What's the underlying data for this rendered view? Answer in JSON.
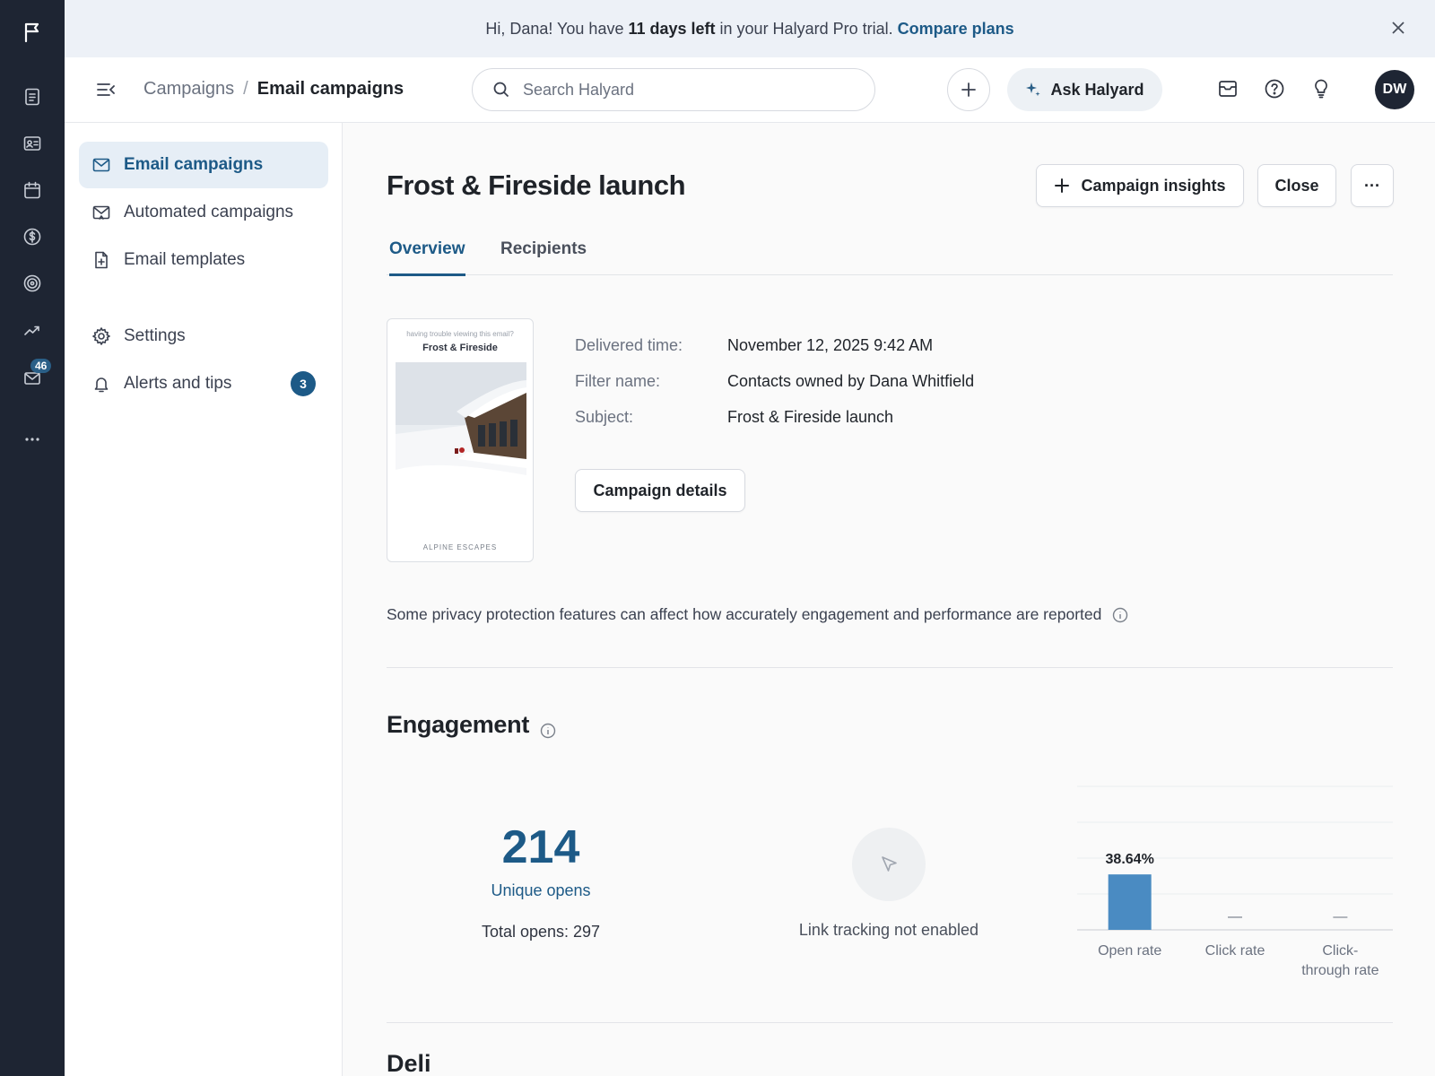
{
  "banner": {
    "text_before": "Hi, Dana! You have",
    "highlight": "11 days left",
    "text_after": "in your Halyard Pro trial.",
    "link": "Compare plans"
  },
  "rail": {
    "icons": [
      "flag-logo-icon",
      "document-icon",
      "contact-card-icon",
      "calendar-icon",
      "dollar-icon",
      "target-icon",
      "trend-icon",
      "mail-icon",
      "more-icon"
    ],
    "mail_count": "46"
  },
  "header": {
    "breadcrumb_parent": "Campaigns",
    "breadcrumb_separator": "/",
    "breadcrumb_current": "Email campaigns",
    "search_placeholder": "Search Halyard",
    "ask_label": "Ask Halyard",
    "avatar_initials": "DW"
  },
  "sidebar": {
    "items": [
      {
        "label": "Email campaigns",
        "icon": "mail-icon",
        "active": true
      },
      {
        "label": "Automated campaigns",
        "icon": "mail-auto-icon"
      },
      {
        "label": "Email templates",
        "icon": "template-icon"
      },
      {
        "label": "Settings",
        "icon": "gear-icon"
      },
      {
        "label": "Alerts and tips",
        "icon": "bell-icon",
        "badge": "3"
      }
    ]
  },
  "main": {
    "title": "Frost & Fireside launch",
    "actions": {
      "insights": "Campaign insights",
      "close": "Close",
      "more": "···"
    },
    "tabs": [
      {
        "label": "Overview",
        "active": true
      },
      {
        "label": "Recipients"
      }
    ],
    "preview": {
      "pre_header": "having trouble viewing this email?",
      "brand": "Frost & Fireside",
      "footer": "ALPINE ESCAPES"
    },
    "details": [
      {
        "label": "Delivered time:",
        "value": "November 12, 2025 9:42 AM"
      },
      {
        "label": "Filter name:",
        "value": "Contacts owned by Dana Whitfield"
      },
      {
        "label": "Subject:",
        "value": "Frost & Fireside launch"
      }
    ],
    "details_button": "Campaign details",
    "privacy_note": "Some privacy protection features can affect how accurately engagement and performance are reported",
    "engagement": {
      "title": "Engagement",
      "unique_opens": "214",
      "unique_opens_label": "Unique opens",
      "total_opens": "Total opens: 297",
      "link_tracking": "Link tracking not enabled"
    },
    "next_section_title": "Deli"
  },
  "chart_data": {
    "type": "bar",
    "categories": [
      "Open rate",
      "Click rate",
      "Click-through rate"
    ],
    "values": [
      38.64,
      null,
      null
    ],
    "data_labels": [
      "38.64%",
      "—",
      "—"
    ],
    "ylim": [
      0,
      100
    ],
    "grid": true,
    "colors": {
      "bar": "#4a8bc2"
    }
  },
  "colors": {
    "accent": "#1d5a87",
    "rail": "#1e2533",
    "banner_bg": "#edf1f7",
    "active_nav_bg": "#e6eef6"
  }
}
